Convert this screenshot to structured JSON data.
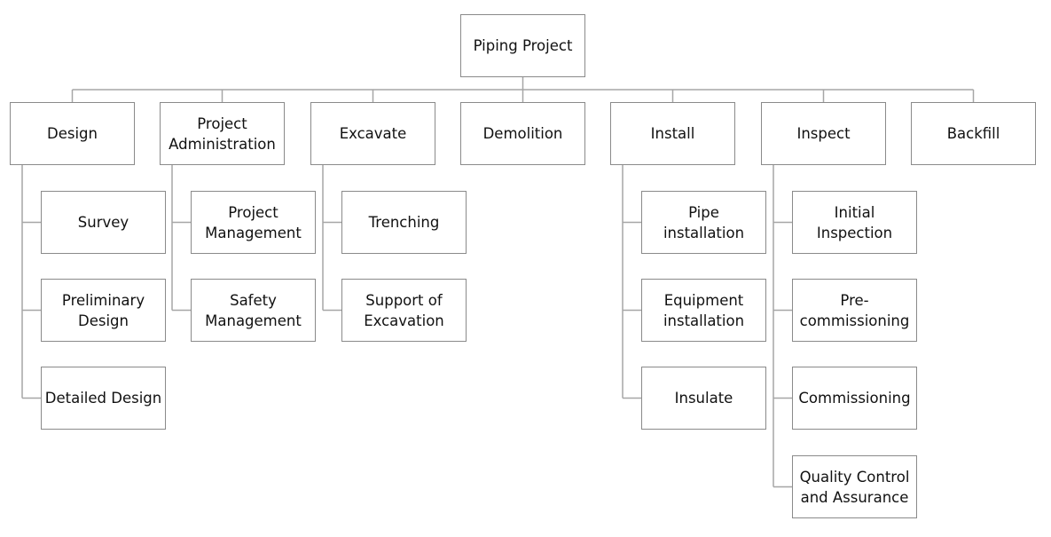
{
  "diagram": {
    "type": "work-breakdown-structure",
    "root": "Piping Project",
    "branches": [
      {
        "label": "Design",
        "children": [
          "Survey",
          "Preliminary\nDesign",
          "Detailed Design"
        ]
      },
      {
        "label": "Project\nAdministration",
        "children": [
          "Project\nManagement",
          "Safety\nManagement"
        ]
      },
      {
        "label": "Excavate",
        "children": [
          "Trenching",
          "Support of\nExcavation"
        ]
      },
      {
        "label": "Demolition",
        "children": []
      },
      {
        "label": "Install",
        "children": [
          "Pipe\ninstallation",
          "Equipment\ninstallation",
          "Insulate"
        ]
      },
      {
        "label": "Inspect",
        "children": [
          "Initial\nInspection",
          "Pre-\ncommissioning",
          "Commissioning",
          "Quality Control\nand Assurance"
        ]
      },
      {
        "label": "Backfill",
        "children": []
      }
    ]
  }
}
